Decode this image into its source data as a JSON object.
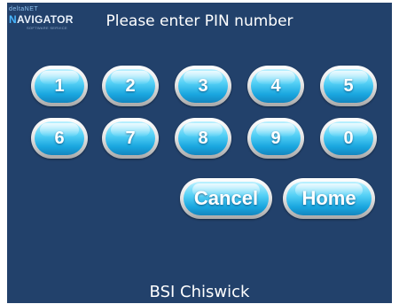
{
  "logo": {
    "small_text": "deltaNET",
    "main_prefix": "N",
    "main_text": "AVIGATOR",
    "tagline": "SOFTWARE SERVICE"
  },
  "title": "Please enter PIN number",
  "keypad": {
    "row1": [
      "1",
      "2",
      "3",
      "4",
      "5"
    ],
    "row2": [
      "6",
      "7",
      "8",
      "9",
      "0"
    ]
  },
  "actions": {
    "cancel": "Cancel",
    "home": "Home"
  },
  "footer": "BSI Chiswick",
  "colors": {
    "background": "#22416b",
    "button_blue": "#2bb3e8"
  }
}
